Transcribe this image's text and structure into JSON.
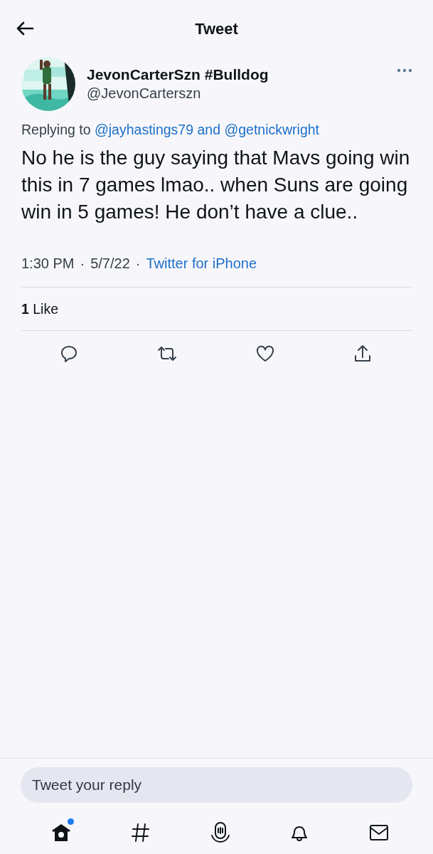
{
  "header": {
    "title": "Tweet"
  },
  "tweet": {
    "author": {
      "name": "JevonCarterSzn #Bulldog",
      "handle": "@JevonCarterszn"
    },
    "replying": {
      "prefix": "Replying to",
      "mentions": [
        "@jayhastings79",
        "@getnickwright"
      ],
      "joiner": "and"
    },
    "text": "No he is the guy saying that Mavs going win this in 7 games lmao.. when Suns are going win in 5 games! He don’t have a clue..",
    "meta": [
      {
        "kind": "text",
        "text": "1:30 PM"
      },
      {
        "kind": "text",
        "text": "·"
      },
      {
        "kind": "text",
        "text": "5/7/22"
      },
      {
        "kind": "text",
        "text": "·"
      },
      {
        "kind": "link",
        "text": "Twitter for iPhone"
      }
    ],
    "likes": {
      "count": "1",
      "label": "Like"
    },
    "actions": [
      {
        "kind": "reply"
      },
      {
        "kind": "retweet"
      },
      {
        "kind": "like"
      },
      {
        "kind": "share"
      }
    ]
  },
  "reply_box": {
    "placeholder": "Tweet your reply"
  },
  "nav": [
    {
      "kind": "home",
      "selected": true,
      "dot": true
    },
    {
      "kind": "explore",
      "selected": false,
      "dot": false
    },
    {
      "kind": "spaces",
      "selected": false,
      "dot": false
    },
    {
      "kind": "notifications",
      "selected": false,
      "dot": false
    },
    {
      "kind": "messages",
      "selected": false,
      "dot": false
    }
  ]
}
